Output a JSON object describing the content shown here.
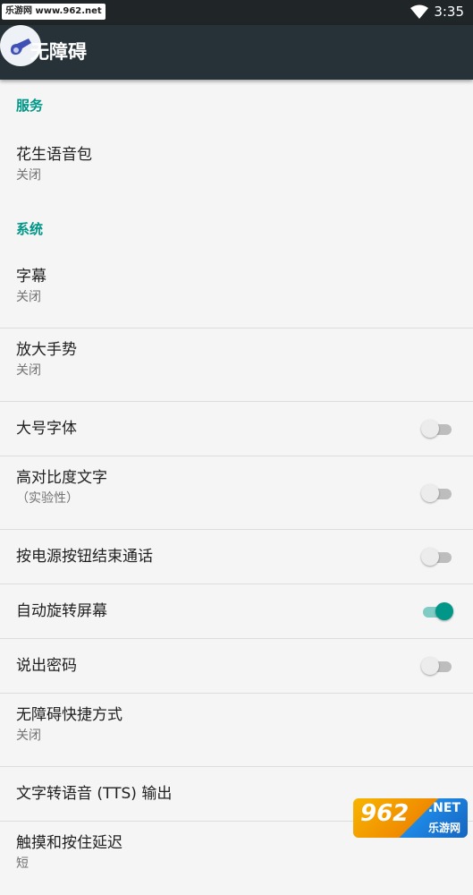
{
  "status_bar": {
    "watermark_text": "乐游网 www.962.net",
    "time": "3:35"
  },
  "app_bar": {
    "title": "无障碍",
    "accent_color": "#263238"
  },
  "sections": {
    "services": {
      "header": "服务",
      "items": [
        {
          "title": "花生语音包",
          "summary": "关闭"
        }
      ]
    },
    "system": {
      "header": "系统",
      "items": [
        {
          "title": "字幕",
          "summary": "关闭"
        },
        {
          "title": "放大手势",
          "summary": "关闭"
        },
        {
          "title": "大号字体",
          "switch_on": false
        },
        {
          "title": "高对比度文字",
          "summary": "（实验性）",
          "switch_on": false
        },
        {
          "title": "按电源按钮结束通话",
          "switch_on": false
        },
        {
          "title": "自动旋转屏幕",
          "switch_on": true
        },
        {
          "title": "说出密码",
          "switch_on": false
        },
        {
          "title": "无障碍快捷方式",
          "summary": "关闭"
        },
        {
          "title": "文字转语音 (TTS) 输出"
        },
        {
          "title": "触摸和按住延迟",
          "summary": "短"
        }
      ]
    }
  },
  "watermark": {
    "logo": "962",
    "net": ".NET",
    "sub": "乐游网"
  },
  "colors": {
    "section_header": "#009688",
    "switch_on": "#009688",
    "switch_off": "#bdbdbd"
  }
}
